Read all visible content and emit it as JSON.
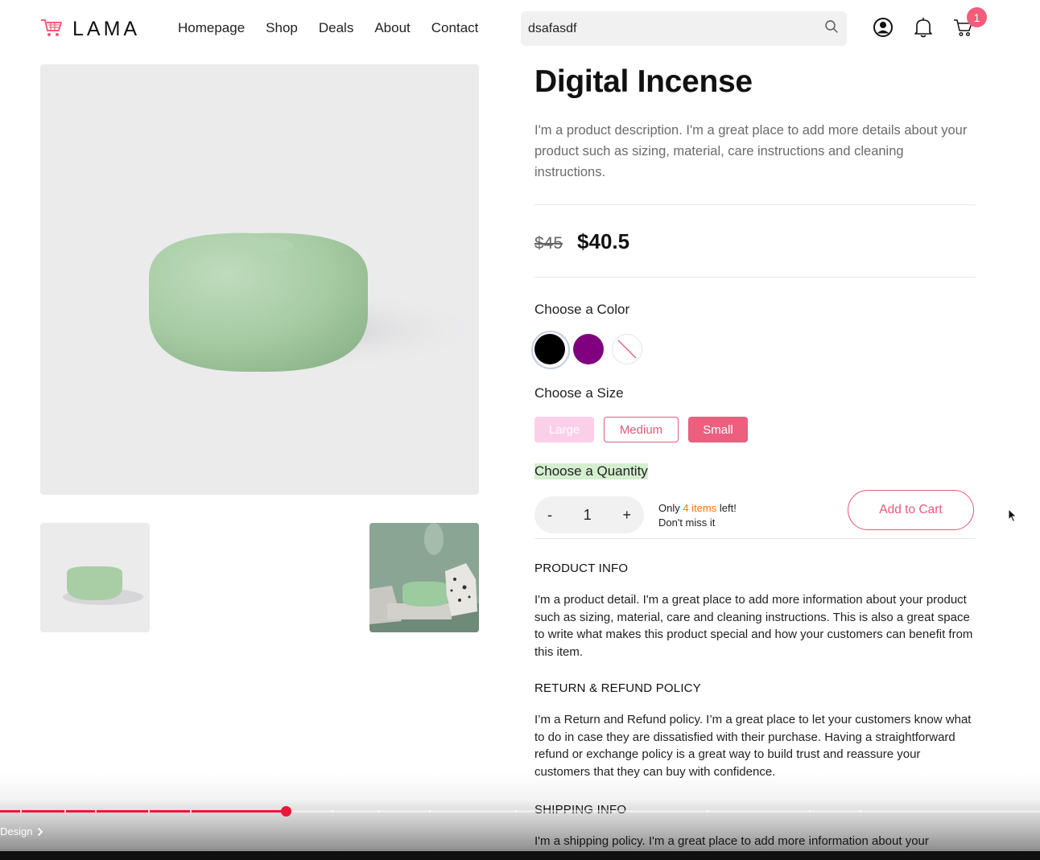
{
  "header": {
    "brand": "LAMA",
    "nav": [
      "Homepage",
      "Shop",
      "Deals",
      "About",
      "Contact"
    ],
    "search_value": "dsafasdf",
    "cart_count": "1"
  },
  "product": {
    "title": "Digital Incense",
    "description": "I'm a product description. I'm a great place to add more details about your product such as sizing, material, care instructions and cleaning instructions.",
    "old_price": "$45",
    "new_price": "$40.5",
    "color_label": "Choose a Color",
    "colors": [
      {
        "name": "black",
        "hex": "#000000",
        "selected": true
      },
      {
        "name": "purple",
        "hex": "#800080",
        "selected": false
      },
      {
        "name": "unavailable",
        "hex": "#ffffff",
        "selected": false
      }
    ],
    "size_label": "Choose a Size",
    "sizes": {
      "large": "Large",
      "medium": "Medium",
      "small": "Small"
    },
    "quantity_label": "Choose a Quantity",
    "quantity": {
      "minus": "-",
      "value": "1",
      "plus": "+"
    },
    "stock": {
      "prefix": "Only ",
      "highlight": "4 items",
      "suffix": " left!",
      "line2": "Don't miss it"
    },
    "add_to_cart": "Add to Cart",
    "sections": [
      {
        "title": "PRODUCT INFO",
        "body": "I'm a product detail. I'm a great place to add more information about your product such as sizing, material, care and cleaning instructions. This is also a great space to write what makes this product special and how your customers can benefit from this item."
      },
      {
        "title": "RETURN & REFUND POLICY",
        "body": "I’m a Return and Refund policy. I’m a great place to let your customers know what to do in case they are dissatisfied with their purchase. Having a straightforward refund or exchange policy is a great way to build trust and reassure your customers that they can buy with confidence."
      },
      {
        "title": "SHIPPING INFO",
        "body": "I'm a shipping policy. I'm a great place to add more information about your"
      }
    ]
  },
  "video": {
    "progress": 0.275,
    "chapter": "Design"
  },
  "colors": {
    "accent": "#f35c7a",
    "product_green": "#a8cfa6",
    "stock_highlight": "#f97316"
  }
}
